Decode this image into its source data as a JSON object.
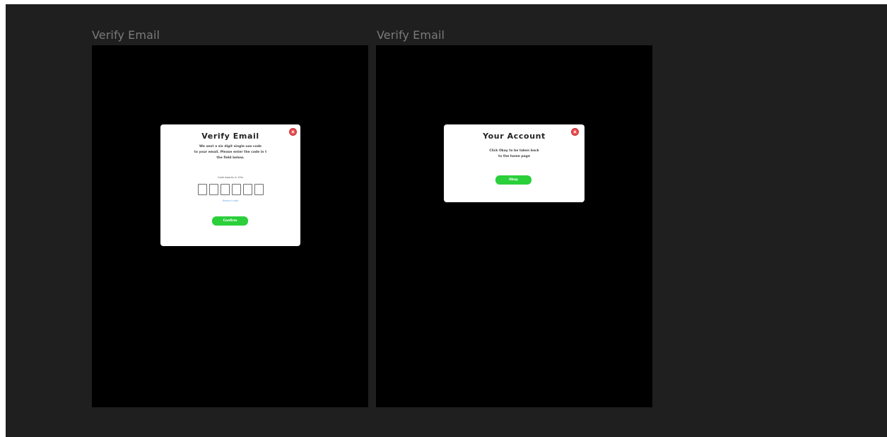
{
  "frames": [
    {
      "label": "Verify Email",
      "modal": {
        "title": "Verify Email",
        "body_lines": [
          "We sent a six digit single use code",
          "to your email. Please enter the code in t",
          "the field below."
        ],
        "code_note": "Code expires in 10m",
        "code_length": 6,
        "resend_label": "Resend code",
        "button_label": "Confirm"
      }
    },
    {
      "label": "Verify Email",
      "modal": {
        "title": "Your Account",
        "body_lines": [
          "Click Okay to be taken back",
          "to the home page"
        ],
        "button_label": "Okay"
      }
    }
  ],
  "colors": {
    "canvas_bg": "#1f1f1f",
    "frame_bg": "#000000",
    "modal_bg": "#ffffff",
    "accent_green": "#2bcf3a",
    "close_red": "#e8484a",
    "link_blue": "#6aa6e8"
  },
  "icons": {
    "close": "close-circle-icon"
  }
}
